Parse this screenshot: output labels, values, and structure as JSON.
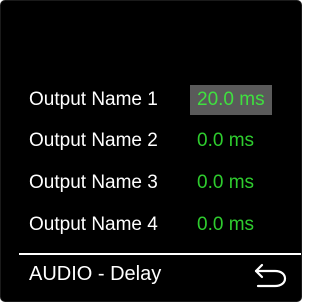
{
  "screen": {
    "background": "#000000",
    "value_color": "#2ecc2e",
    "selected_bg": "#5a5a5a"
  },
  "outputs": [
    {
      "label": "Output Name 1",
      "value": "20.0 ms",
      "selected": true
    },
    {
      "label": "Output Name 2",
      "value": "0.0 ms",
      "selected": false
    },
    {
      "label": "Output Name 3",
      "value": "0.0 ms",
      "selected": false
    },
    {
      "label": "Output Name 4",
      "value": "0.0 ms",
      "selected": false
    }
  ],
  "footer": {
    "title": "AUDIO - Delay",
    "back_icon": "return-arrow-icon"
  }
}
